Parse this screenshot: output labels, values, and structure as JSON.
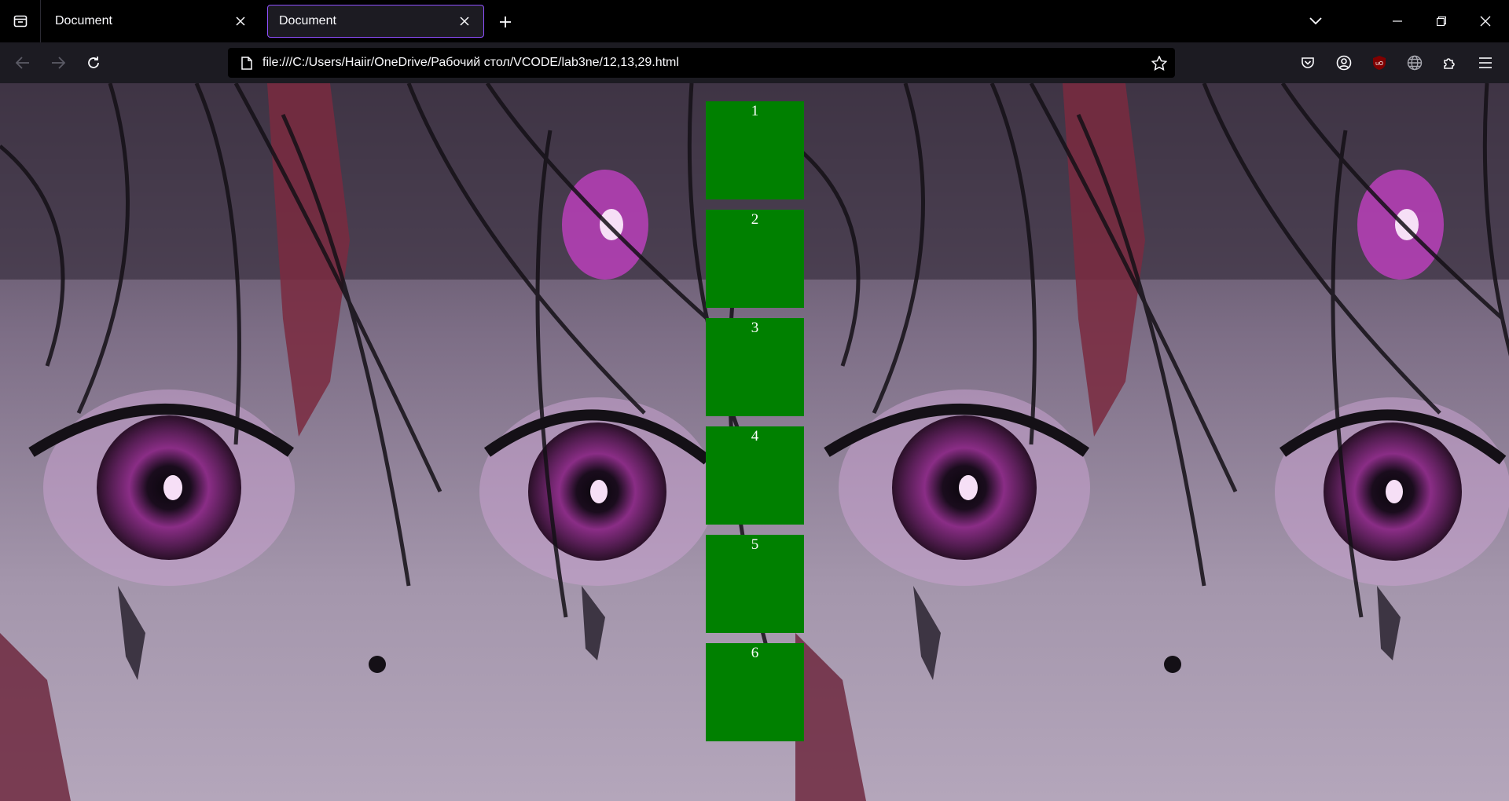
{
  "browser": {
    "tabs": [
      {
        "title": "Document",
        "active": false
      },
      {
        "title": "Document",
        "active": true
      }
    ],
    "url": "file:///C:/Users/Haiir/OneDrive/Рабочий стол/VCODE/lab3ne/12,13,29.html",
    "accent_color": "#8f50ff"
  },
  "page": {
    "boxes": [
      "1",
      "2",
      "3",
      "4",
      "5",
      "6"
    ],
    "box_color": "#008000",
    "box_text_color": "#ffffff"
  }
}
